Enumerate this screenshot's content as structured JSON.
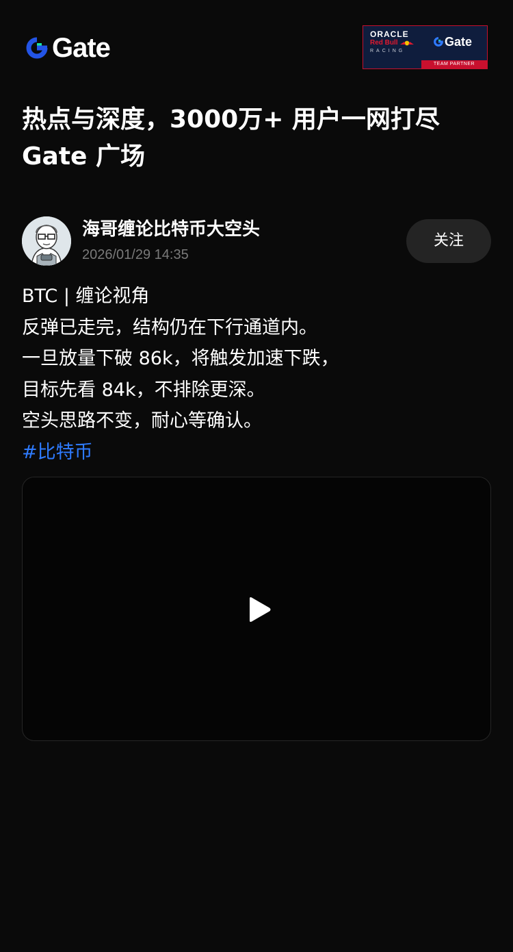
{
  "header": {
    "logo_text": "Gate",
    "partner": {
      "oracle": "ORACLE",
      "redbull": "Red Bull",
      "racing": "RACING",
      "gate": "Gate",
      "strip": "TEAM PARTNER"
    }
  },
  "headline": {
    "line1": "热点与深度，3000万+ 用户一网打尽",
    "line2": "Gate 广场"
  },
  "post": {
    "author_name": "海哥缠论比特币大空头",
    "time": "2026/01/29 14:35",
    "follow_label": "关注",
    "lines": [
      "BTC | 缠论视角",
      "反弹已走完，结构仍在下行通道内。",
      "一旦放量下破 86k，将触发加速下跌，",
      "目标先看 84k，不排除更深。",
      "空头思路不变，耐心等确认。"
    ],
    "hashtag": "#比特币"
  },
  "colors": {
    "background": "#0a0a0a",
    "brand_blue": "#2354e6",
    "brand_green": "#17e6a1",
    "hashtag": "#2e7bff",
    "follow_bg": "#242424",
    "timestamp": "#7a7a7a",
    "partner_navy": "#0f1d3d",
    "partner_red": "#c8102e"
  },
  "icons": {
    "logo": "gate-logo-icon",
    "play": "play-icon"
  }
}
